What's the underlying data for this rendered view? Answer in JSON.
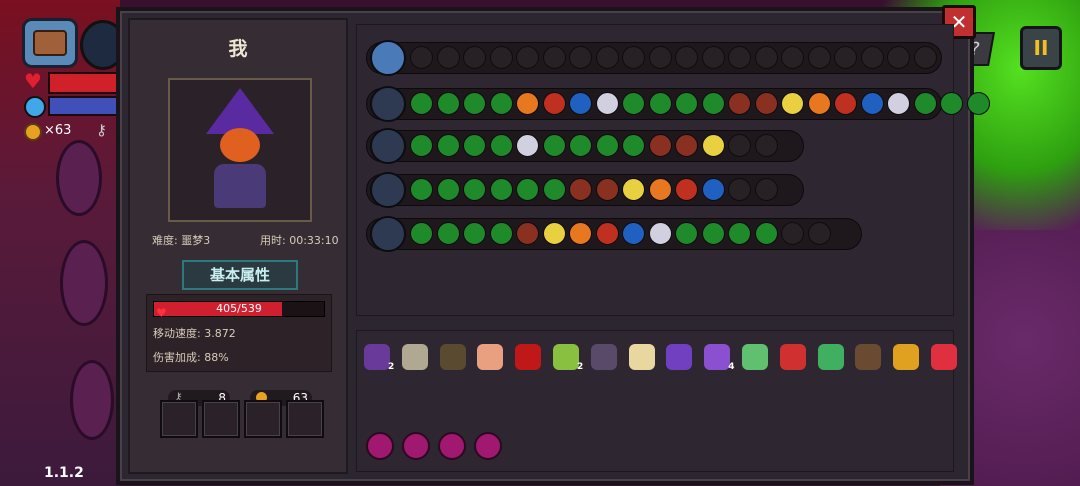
{
  "hud": {
    "coin_count": "×63",
    "version": "1.1.2"
  },
  "buttons": {
    "close": "✕",
    "pause": "II",
    "help": "?"
  },
  "character": {
    "name": "我",
    "difficulty": "难度: 噩梦3",
    "time": "用时: 00:33:10",
    "attr_title": "基本属性",
    "hp_text": "405/539",
    "hp_fraction": 0.751,
    "move_speed": "移动速度: 3.872",
    "damage_bonus": "伤害加成: 88%",
    "keys": "8",
    "coins": "63"
  },
  "item_subscripts": {
    "i1": "2",
    "i6": "2",
    "i10": "4"
  },
  "colors": {
    "hp": "#d02030",
    "mana": "#4050b8",
    "accent": "#2a7a80",
    "close": "#c03030",
    "pause_icon": "#f0c020"
  }
}
